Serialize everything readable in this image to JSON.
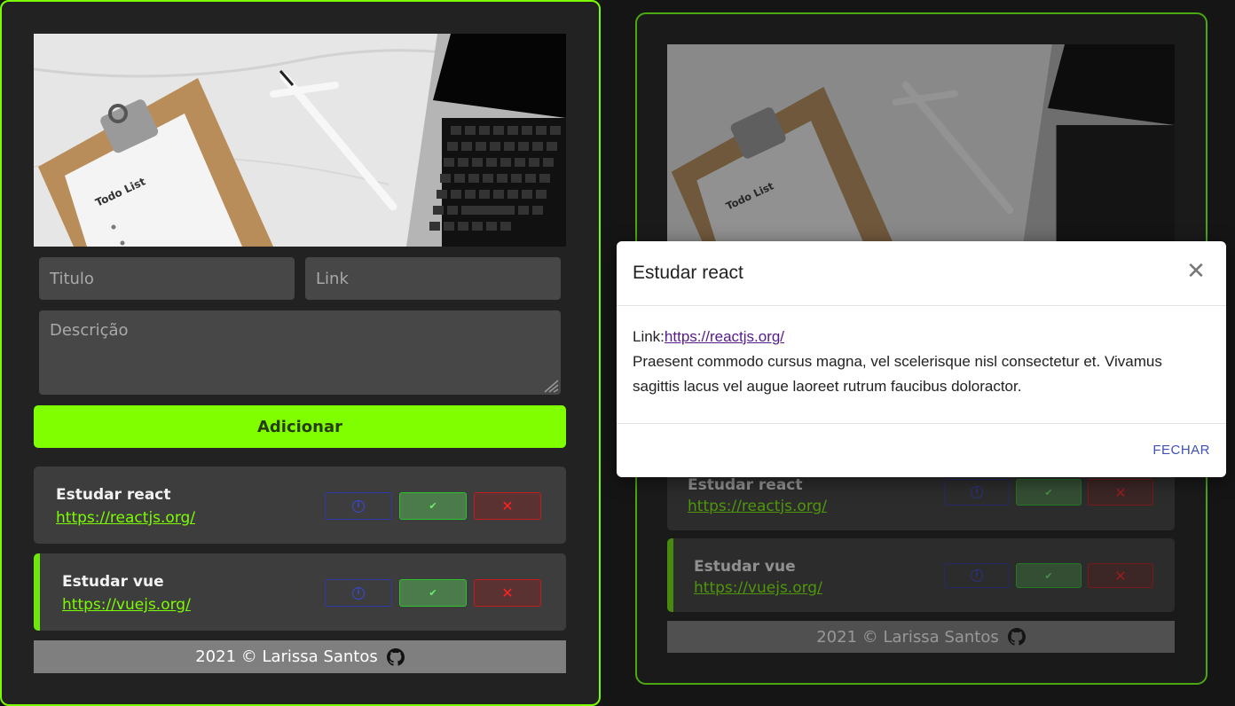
{
  "form": {
    "title_placeholder": "Titulo",
    "link_placeholder": "Link",
    "description_placeholder": "Descrição",
    "add_label": "Adicionar"
  },
  "hero": {
    "clipboard_text": "Todo List"
  },
  "todos": [
    {
      "title": "Estudar react",
      "link": "https://reactjs.org/",
      "completed": false
    },
    {
      "title": "Estudar vue",
      "link": "https://vuejs.org/",
      "completed": true
    }
  ],
  "actions": {
    "info_icon": "i",
    "done_icon": "✔",
    "delete_icon": "✕"
  },
  "footer": {
    "text": "2021 © Larissa Santos",
    "icon": "github-icon"
  },
  "modal": {
    "title": "Estudar react",
    "link_label": "Link:",
    "link": "https://reactjs.org/",
    "description": "Praesent commodo cursus magna, vel scelerisque nisl consectetur et. Vivamus sagittis lacus vel augue laoreet rutrum faucibus doloractor.",
    "close_label": "FECHAR"
  },
  "colors": {
    "accent": "#7fff00",
    "card": "#3d3d3d",
    "footer": "#7f7f7f",
    "modal_button": "#3f51b5"
  }
}
